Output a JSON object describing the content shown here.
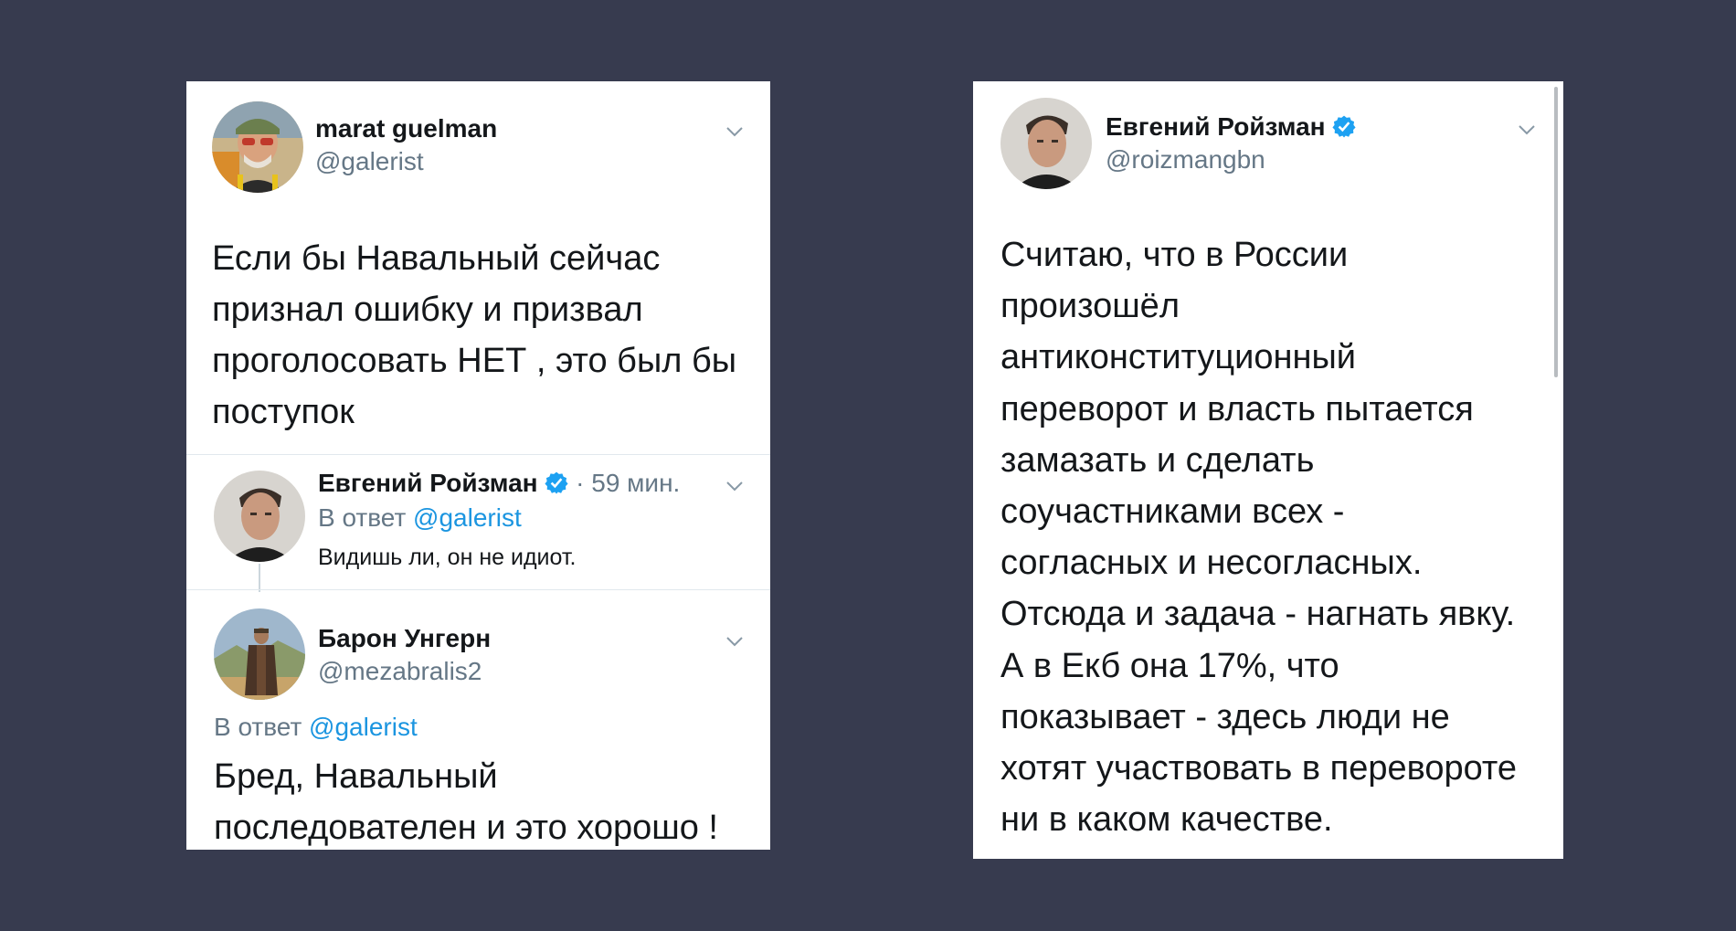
{
  "left_card": {
    "main_tweet": {
      "author_name": "marat guelman",
      "author_handle": "@galerist",
      "text_lines": [
        "Если бы Навальный сейчас",
        "признал ошибку и призвал",
        "проголосовать НЕТ , это был бы",
        "поступок"
      ]
    },
    "reply_1": {
      "author_name": "Евгений Ройзман",
      "time": "· 59 мин.",
      "reply_prefix": "В ответ",
      "reply_to": "@galerist",
      "text": "Видишь ли, он не идиот."
    },
    "reply_2": {
      "author_name": "Барон Унгерн",
      "author_handle": "@mezabralis2",
      "reply_prefix": "В ответ",
      "reply_to": "@galerist",
      "text_lines": [
        "Бред, Навальный",
        "последователен и это хорошо !"
      ]
    }
  },
  "right_card": {
    "tweet": {
      "author_name": "Евгений Ройзман",
      "author_handle": "@roizmangbn",
      "text_lines": [
        "Считаю, что в России",
        "произошёл",
        "антиконституционный",
        "переворот и власть пытается",
        "замазать и сделать",
        "соучастниками всех -",
        "согласных и несогласных.",
        "Отсюда и задача - нагнать явку.",
        "А в Екб она 17%,  что",
        "показывает  - здесь люди не",
        "хотят участвовать в перевороте",
        "ни в каком качестве."
      ]
    }
  },
  "icons": {
    "chevron": "chevron-down-icon",
    "verified": "verified-badge-icon"
  },
  "colors": {
    "background": "#373b4f",
    "link": "#1b95e0",
    "verified": "#1da1f2",
    "muted": "#657786",
    "text": "#14171a"
  }
}
